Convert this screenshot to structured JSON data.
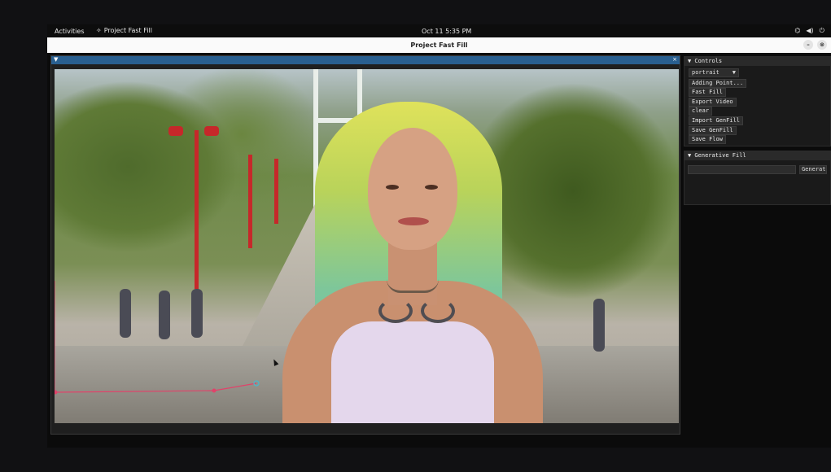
{
  "topbar": {
    "activities": "Activities",
    "app_name": "Project Fast Fill",
    "clock": "Oct 11  5:35 PM",
    "icons": [
      "network-icon",
      "volume-icon",
      "power-icon"
    ]
  },
  "window": {
    "title": "Project Fast Fill",
    "minimize_symbol": "–",
    "close_symbol": "⊗"
  },
  "viewer": {
    "collapse_symbol": "▼",
    "close_symbol": "×"
  },
  "controls": {
    "header": "▼ Controls",
    "mode_select": "portrait",
    "buttons": {
      "adding_point": "Adding Point...",
      "fast_fill": "Fast Fill",
      "export_video": "Export Video",
      "clear": "clear",
      "import_genfill": "Import GenFill",
      "save_genfill": "Save GenFill",
      "save_flow": "Save Flow"
    }
  },
  "generative_fill": {
    "header": "▼ Generative Fill",
    "generate_label": "Generate"
  },
  "colors": {
    "viewer_header": "#295f90",
    "overlay_line": "#e0436a",
    "overlay_point_end": "#4fb4c8"
  }
}
